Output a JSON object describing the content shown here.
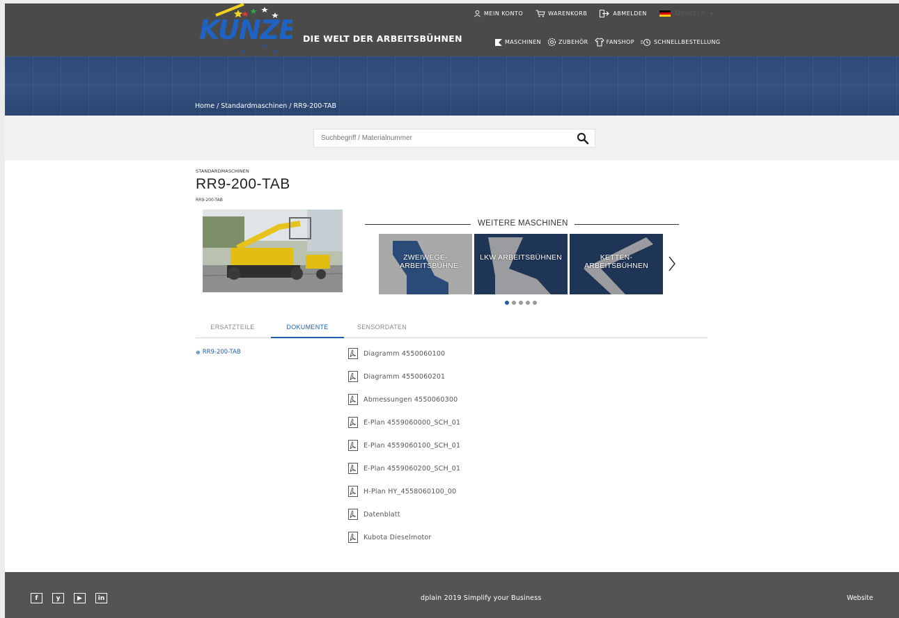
{
  "header": {
    "logo_text": "KUNZE",
    "tagline": "DIE WELT DER ARBEITSBÜHNEN",
    "top_nav": [
      {
        "label": "MEIN KONTO",
        "icon": "user-icon"
      },
      {
        "label": "WARENKORB",
        "icon": "cart-icon"
      },
      {
        "label": "ABMELDEN",
        "icon": "logout-icon"
      }
    ],
    "language": {
      "label": "Deutsch",
      "icon": "flag-de-icon"
    },
    "main_nav": [
      {
        "label": "MASCHINEN",
        "icon": "machine-icon"
      },
      {
        "label": "ZUBEHÖR",
        "icon": "gear-icon"
      },
      {
        "label": "FANSHOP",
        "icon": "shirt-icon"
      },
      {
        "label": "SCHNELLBESTELLUNG",
        "icon": "quick-order-icon"
      }
    ]
  },
  "breadcrumb": "Home / Standardmaschinen / RR9-200-TAB",
  "search": {
    "placeholder": "Suchbegriff / Materialnummer"
  },
  "product": {
    "category": "STANDARDMASCHINEN",
    "title": "RR9-200-TAB",
    "subtitle": "RR9-200-TAB"
  },
  "more_machines": {
    "title": "WEITERE MASCHINEN",
    "tiles": [
      {
        "label": "ZWEIWEGE-ARBEITSBÜHNE",
        "bg": "#a9a9a9"
      },
      {
        "label": "LKW ARBEITSBÜHNEN",
        "bg": "#1f3556"
      },
      {
        "label": "KETTEN-ARBEITSBÜHNEN",
        "bg": "#1f3556"
      }
    ],
    "dots_total": 5,
    "dots_active": 1
  },
  "tabs": [
    {
      "label": "ERSATZTEILE",
      "active": false
    },
    {
      "label": "DOKUMENTE",
      "active": true
    },
    {
      "label": "SENSORDATEN",
      "active": false
    }
  ],
  "tree_item": "RR9-200-TAB",
  "documents": [
    "Diagramm 4550060100",
    "Diagramm 4550060201",
    "Abmessungen 4550060300",
    "E-Plan 4559060000_SCH_01",
    "E-Plan 4559060100_SCH_01",
    "E-Plan 4559060200_SCH_01",
    "H-Plan HY_4558060100_00",
    "Datenblatt",
    "Kubota Dieselmotor"
  ],
  "footer": {
    "social": [
      "f",
      "y",
      "▶",
      "in"
    ],
    "center": "dplain 2019  Simplify your Business",
    "right": "Website"
  },
  "colors": {
    "accent": "#1f5ea8",
    "header": "#4a4a4a",
    "footer": "#545454"
  }
}
